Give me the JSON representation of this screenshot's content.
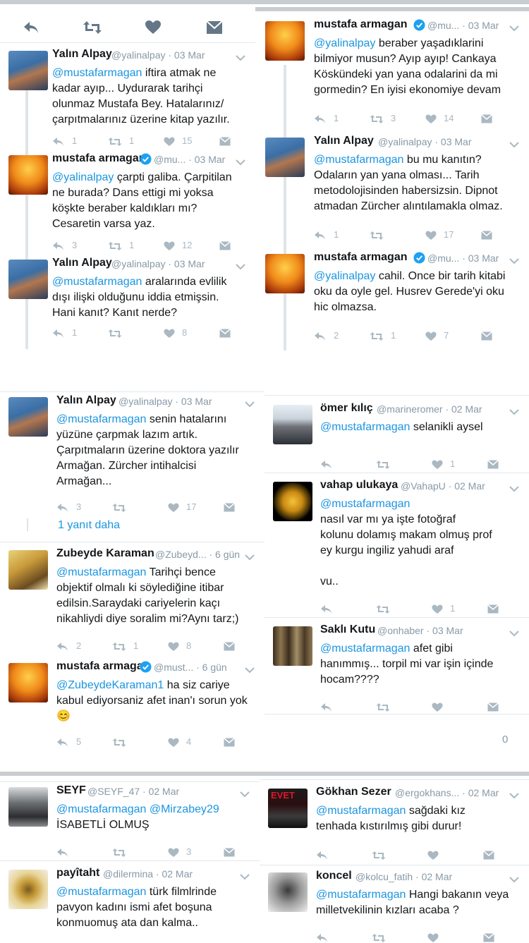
{
  "top_actions": {
    "reply": "reply-icon",
    "retweet": "retweet-icon",
    "like": "heart-icon",
    "dm": "message-icon"
  },
  "left_top": [
    {
      "name": "Yalın Alpay",
      "handle": "@yalinalpay · 03 Mar",
      "mention": "@mustafarmagan",
      "text": " iftira atmak ne\nkadar ayıp... Uydurarak tarihçi\nolunmaz Mustafa Bey. Hatalarınız/\nçarpıtmalarınız üzerine kitap yazılır.",
      "reply": "1",
      "rt": "1",
      "like": "15"
    },
    {
      "name": "mustafa armagan",
      "handle": "@mu... · 03 Mar",
      "mention": "@yalinalpay",
      "text": " çarpti galiba. Çarpitilan\nne burada? Dans ettigi mi yoksa\nköşkte beraber kaldıkları mı?\nCesaretin varsa yaz.",
      "reply": "3",
      "rt": "1",
      "like": "12"
    },
    {
      "name": "Yalın Alpay",
      "handle": "@yalinalpay · 03 Mar",
      "mention": "@mustafarmagan",
      "text": " aralarında evlilik\ndışı ilişki olduğunu iddia etmişsin.\nHani kanıt? Kanıt nerde?",
      "reply": "1",
      "rt": "",
      "like": "8"
    }
  ],
  "right_top": [
    {
      "name": "mustafa armagan",
      "handle": "@mu... · 03 Mar",
      "mention": "@yalinalpay",
      "text": " beraber yaşadıklarini\nbilmiyor musun? Ayıp ayıp! Cankaya\nKöskündeki yan yana odalarini da mi\ngormedin? En iyisi ekonomiye devam",
      "reply": "1",
      "rt": "3",
      "like": "14"
    },
    {
      "name": "Yalın Alpay",
      "handle": "@yalinalpay · 03 Mar",
      "mention": "@mustafarmagan",
      "text": " bu mu kanıtın?\nOdaların yan yana olması... Tarih\nmetodolojisinden habersizsin. Dipnot\natmadan Zürcher alıntılamakla olmaz.",
      "reply": "1",
      "rt": "",
      "like": "17"
    },
    {
      "name": "mustafa armagan",
      "handle": "@mu... · 03 Mar",
      "mention": "@yalinalpay",
      "text": " cahil. Once bir tarih kitabi\noku da oyle gel. Husrev Gerede'yi oku\nhic olmazsa.",
      "reply": "2",
      "rt": "1",
      "like": "7"
    }
  ],
  "left_mid": [
    {
      "name": "Yalın Alpay",
      "handle": "@yalinalpay · 03 Mar",
      "mention": "@mustafarmagan",
      "text": " senin hatalarını\nyüzüne çarpmak lazım artık.\nÇarpıtmaların üzerine doktora yazılır\nArmağan. Zürcher intihalcisi\nArmağan...",
      "reply": "3",
      "rt": "",
      "like": "17"
    },
    {
      "name": "Zubeyde Karaman",
      "handle": "@Zubeyd... · 6 gün",
      "mention": "@mustafarmagan",
      "text": " Tarihçi bence\nobjektif olmalı ki söylediğine itibar\nedilsin.Saraydaki cariyelerin kaçı\nnikahliydi diye soralim mi?Aynı tarz;)",
      "reply": "2",
      "rt": "1",
      "like": "8"
    },
    {
      "name": "mustafa armagan",
      "handle": "@must... · 6 gün",
      "mention": "@ZubeydeKaraman1",
      "text": " ha siz cariye\nkabul ediyorsaniz afet inan'ı sorun yok\n😊",
      "reply": "5",
      "rt": "",
      "like": "4"
    }
  ],
  "more_replies": "1 yanıt daha",
  "right_mid": [
    {
      "name": "ömer kılıç",
      "handle": "@marineromer · 02 Mar",
      "mention": "@mustafarmagan",
      "text": " selanikli aysel",
      "reply": "",
      "rt": "",
      "like": "1"
    },
    {
      "name": "vahap ulukaya",
      "handle": "@VahapU · 02 Mar",
      "mention": "@mustafarmagan",
      "text": "\nnasıl var mı ya işte fotoğraf\nkolunu dolamış makam olmuş prof\ney kurgu ingiliz yahudi araf\n\nvu..",
      "reply": "",
      "rt": "",
      "like": "1"
    },
    {
      "name": "Saklı Kutu",
      "handle": "@onhaber · 03 Mar",
      "mention": "@mustafarmagan",
      "text": " afet gibi\nhanımmış... torpil mi var işin içinde\nhocam????",
      "reply": "",
      "rt": "",
      "like": ""
    }
  ],
  "zero_count": "0",
  "left_bottom": [
    {
      "name": "SEYF",
      "handle": "@SEYF_47 · 02 Mar",
      "mention": "@mustafarmagan @Mirzabey29",
      "text": "\nİSABETLİ OLMUŞ",
      "reply": "",
      "rt": "",
      "like": "3"
    },
    {
      "name": "payîtaht",
      "handle": "@dilermina · 02 Mar",
      "mention": "@mustafarmagan",
      "text": " türk filmlrinde\npavyon kadını ismi afet boşuna\nkonmuomuş ata dan kalma..",
      "reply": "",
      "rt": "",
      "like": ""
    }
  ],
  "right_bottom": [
    {
      "name": "Gökhan Sezer",
      "handle": "@ergokhans... · 02 Mar",
      "mention": "@mustafarmagan",
      "text": " sağdaki kız\ntenhada kıstırılmış gibi durur!",
      "reply": "",
      "rt": "",
      "like": ""
    },
    {
      "name": "koncel",
      "handle": "@kolcu_fatih · 02 Mar",
      "mention": "@mustafarmagan",
      "text": " Hangi bakanın veya\nmilletvekilinin kızları acaba ?",
      "reply": "",
      "rt": "",
      "like": ""
    }
  ],
  "gokhan_avatar_text": "EVET",
  "colors": {
    "mention": "#1b95e0",
    "muted": "#aab8c2",
    "verified": "#1da1f2"
  }
}
